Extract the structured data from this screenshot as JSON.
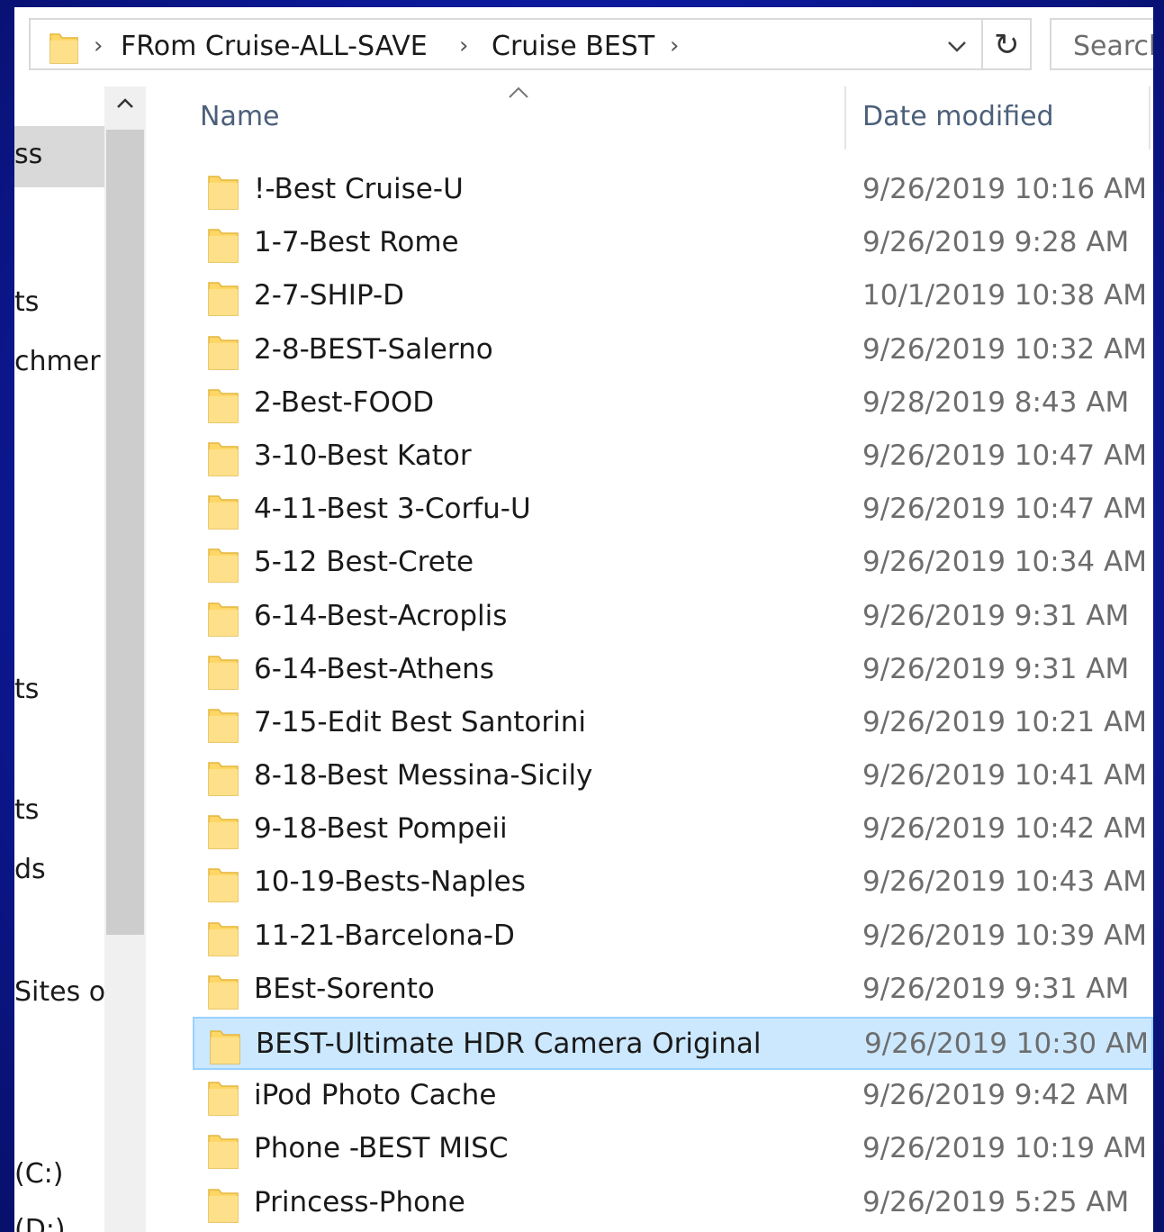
{
  "address_bar": {
    "breadcrumbs": [
      "FRom Cruise-ALL-SAVE",
      "Cruise BEST"
    ],
    "search_placeholder": "Search"
  },
  "nav_pane": {
    "items": [
      {
        "label": "ss",
        "selected": true
      },
      {
        "label": "ts",
        "selected": false
      },
      {
        "label": "chmer",
        "selected": false
      },
      {
        "label": "ts",
        "selected": false
      },
      {
        "label": "ts",
        "selected": false
      },
      {
        "label": "ds",
        "selected": false
      },
      {
        "label": "Sites or",
        "selected": false
      },
      {
        "label": "(C:)",
        "selected": false
      },
      {
        "label": "(D:)",
        "selected": false
      }
    ]
  },
  "columns": {
    "name": "Name",
    "date_modified": "Date modified"
  },
  "files": [
    {
      "name": "!-Best Cruise-U",
      "date": "9/26/2019 10:16 AM"
    },
    {
      "name": "1-7-Best Rome",
      "date": "9/26/2019 9:28 AM"
    },
    {
      "name": "2-7-SHIP-D",
      "date": "10/1/2019 10:38 AM"
    },
    {
      "name": "2-8-BEST-Salerno",
      "date": "9/26/2019 10:32 AM"
    },
    {
      "name": "2-Best-FOOD",
      "date": "9/28/2019 8:43 AM"
    },
    {
      "name": "3-10-Best Kator",
      "date": "9/26/2019 10:47 AM"
    },
    {
      "name": "4-11-Best 3-Corfu-U",
      "date": "9/26/2019 10:47 AM"
    },
    {
      "name": "5-12 Best-Crete",
      "date": "9/26/2019 10:34 AM"
    },
    {
      "name": "6-14-Best-Acroplis",
      "date": "9/26/2019 9:31 AM"
    },
    {
      "name": "6-14-Best-Athens",
      "date": "9/26/2019 9:31 AM"
    },
    {
      "name": "7-15-Edit Best Santorini",
      "date": "9/26/2019 10:21 AM"
    },
    {
      "name": "8-18-Best Messina-Sicily",
      "date": "9/26/2019 10:41 AM"
    },
    {
      "name": "9-18-Best Pompeii",
      "date": "9/26/2019 10:42 AM"
    },
    {
      "name": "10-19-Bests-Naples",
      "date": "9/26/2019 10:43 AM"
    },
    {
      "name": "11-21-Barcelona-D",
      "date": "9/26/2019 10:39 AM"
    },
    {
      "name": "BEst-Sorento",
      "date": "9/26/2019 9:31 AM"
    },
    {
      "name": "BEST-Ultimate HDR Camera Original",
      "date": "9/26/2019 10:30 AM",
      "selected": true
    },
    {
      "name": "iPod Photo Cache",
      "date": "9/26/2019 9:42 AM"
    },
    {
      "name": "Phone -BEST MISC",
      "date": "9/26/2019 10:19 AM"
    },
    {
      "name": "Princess-Phone",
      "date": "9/26/2019 5:25 AM"
    }
  ],
  "colors": {
    "background": "#0d1a9e",
    "selection": "#cce8ff",
    "folder": "#ffd766"
  }
}
